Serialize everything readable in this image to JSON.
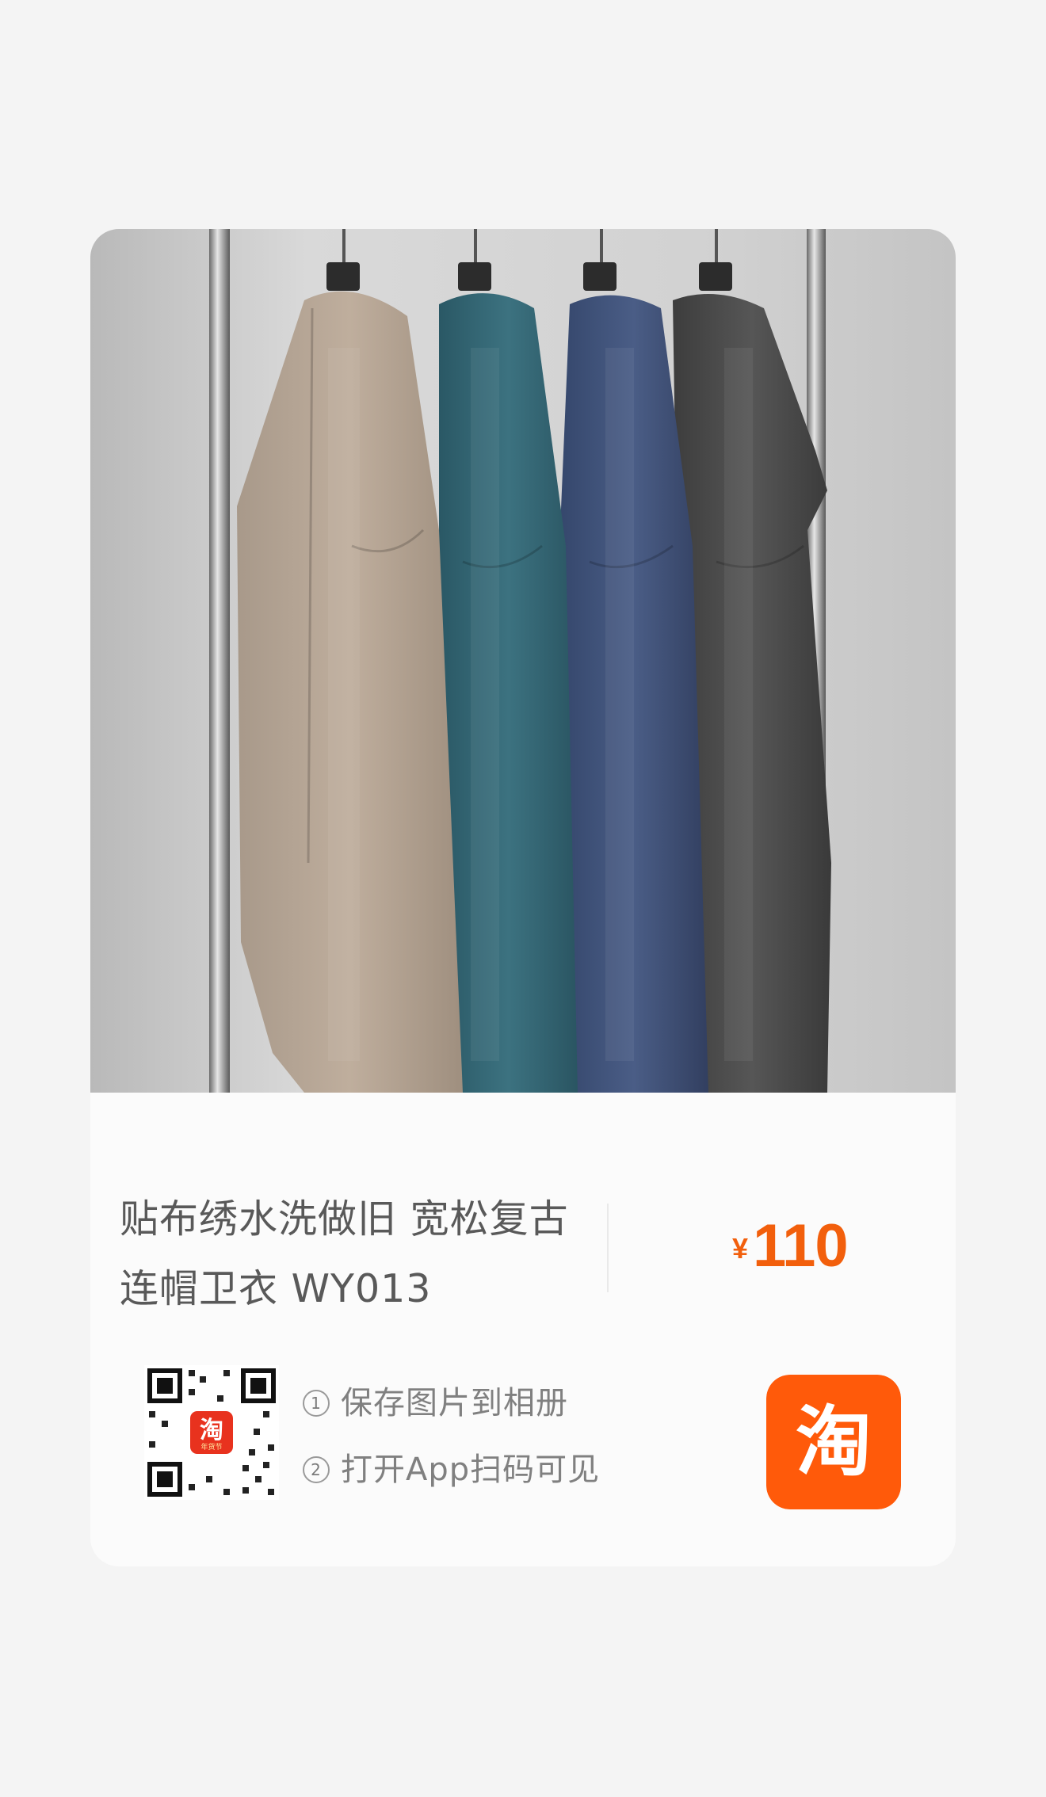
{
  "product": {
    "title_line1": "贴布绣水洗做旧 宽松复古",
    "title_line2": "连帽卫衣 WY013",
    "currency": "¥",
    "price": "110"
  },
  "instructions": [
    {
      "num": "1",
      "text": "保存图片到相册"
    },
    {
      "num": "2",
      "text": "打开App扫码可见"
    }
  ],
  "qr_badge": {
    "glyph": "淘",
    "sub": "年货节"
  },
  "app_logo": {
    "glyph": "淘"
  },
  "colors": {
    "accent": "#f25f0c",
    "brand": "#ff5000"
  }
}
